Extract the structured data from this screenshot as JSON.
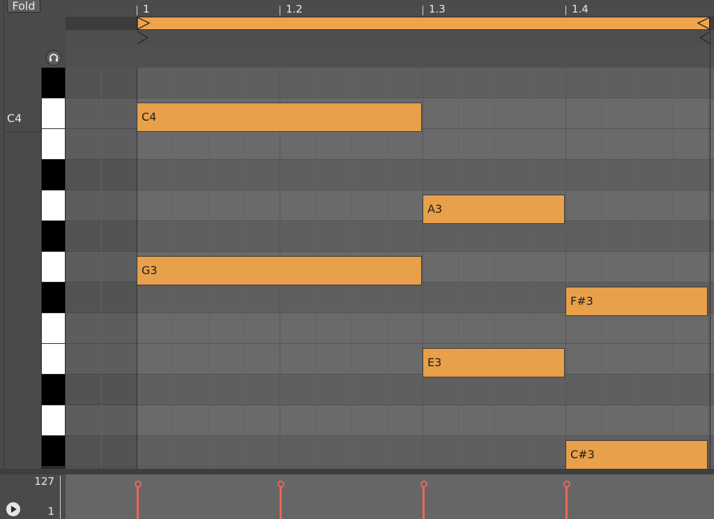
{
  "fold_label": "Fold",
  "ruler": {
    "bars": [
      "1",
      "1.2",
      "1.3",
      "1.4"
    ]
  },
  "piano": {
    "c_label": "C4"
  },
  "notes": [
    {
      "pitch": "C4",
      "start": 1.0,
      "length": 0.5
    },
    {
      "pitch": "G3",
      "start": 1.0,
      "length": 0.5
    },
    {
      "pitch": "A3",
      "start": 1.5,
      "length": 0.25
    },
    {
      "pitch": "E3",
      "start": 1.5,
      "length": 0.25
    },
    {
      "pitch": "F#3",
      "start": 1.75,
      "length": 0.25
    },
    {
      "pitch": "C#3",
      "start": 1.75,
      "length": 0.25
    }
  ],
  "velocity": {
    "max": "127",
    "min": "1",
    "values": [
      127,
      127,
      127,
      127
    ]
  },
  "colors": {
    "note": "#e8a04a",
    "velocity": "#f26457"
  },
  "icons": {
    "headphones": "headphones-icon",
    "play": "play-icon"
  }
}
